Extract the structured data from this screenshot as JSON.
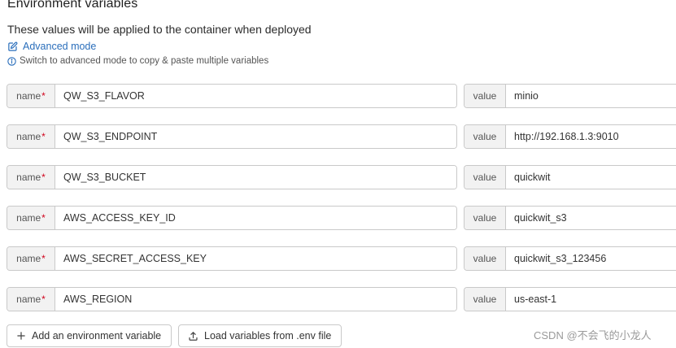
{
  "header": {
    "title": "Environment variables",
    "subtitle": "These values will be applied to the container when deployed"
  },
  "advanced": {
    "link_label": "Advanced mode",
    "hint": "Switch to advanced mode to copy & paste multiple variables"
  },
  "labels": {
    "name": "name",
    "required": "*",
    "value": "value"
  },
  "variables": [
    {
      "name": "QW_S3_FLAVOR",
      "value": "minio"
    },
    {
      "name": "QW_S3_ENDPOINT",
      "value": "http://192.168.1.3:9010"
    },
    {
      "name": "QW_S3_BUCKET",
      "value": "quickwit"
    },
    {
      "name": "AWS_ACCESS_KEY_ID",
      "value": "quickwit_s3"
    },
    {
      "name": "AWS_SECRET_ACCESS_KEY",
      "value": "quickwit_s3_123456"
    },
    {
      "name": "AWS_REGION",
      "value": "us-east-1"
    }
  ],
  "actions": {
    "add_label": "Add an environment variable",
    "load_label": "Load variables from .env file"
  },
  "watermark": "CSDN @不会飞的小龙人",
  "colors": {
    "link": "#2a6ebb",
    "required": "#d0021b",
    "border": "#c9c9c9",
    "addon_bg": "#f2f2f2"
  },
  "icons": {
    "advanced": "edit-icon",
    "hint": "info-circle-icon",
    "add": "plus-icon",
    "load": "upload-icon"
  }
}
